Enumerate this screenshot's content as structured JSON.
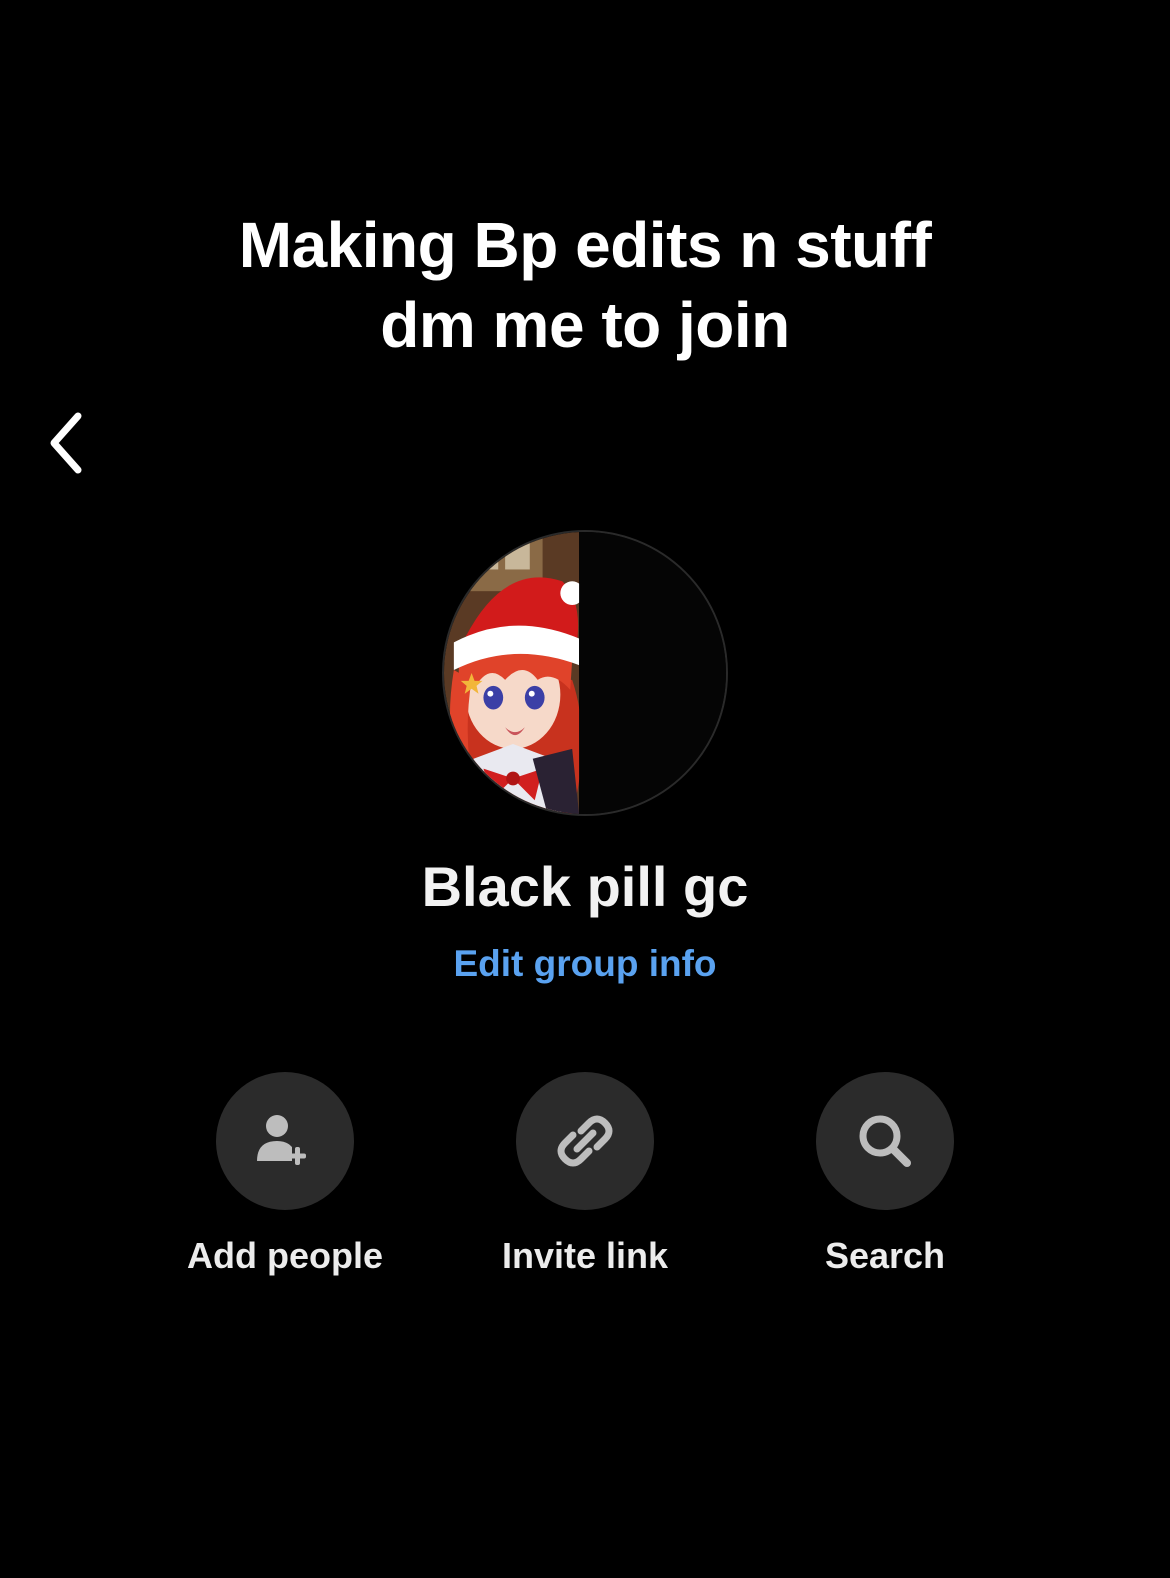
{
  "caption": {
    "line1": "Making Bp edits n stuff",
    "line2": "dm me to join"
  },
  "header": {
    "back_icon": "chevron-left-icon"
  },
  "group": {
    "name": "Black pill gc",
    "edit_label": "Edit group info",
    "avatar": "anime-girl-santa-hat-avatar"
  },
  "actions": [
    {
      "label": "Add people",
      "icon": "add-person-icon"
    },
    {
      "label": "Invite link",
      "icon": "link-icon"
    },
    {
      "label": "Search",
      "icon": "search-icon"
    }
  ],
  "colors": {
    "background": "#000000",
    "link": "#5aa2f0",
    "action_circle": "#2b2b2b",
    "icon": "#bdbdbd"
  }
}
